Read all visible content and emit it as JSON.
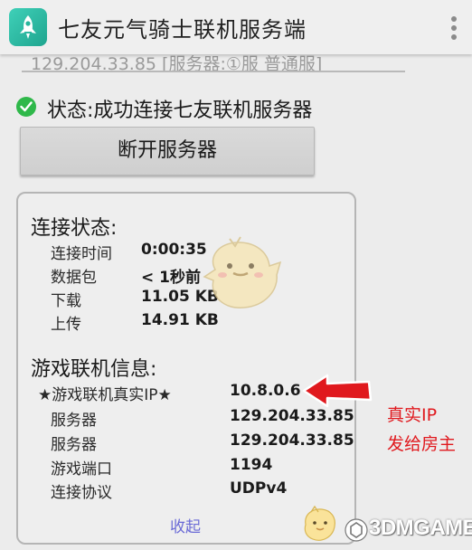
{
  "app": {
    "title": "七友元气骑士联机服务端",
    "icon": "rocket-icon",
    "accent_color": "#27b59c"
  },
  "server_line": "129.204.33.85 [服务器:①服 普通服]",
  "status": {
    "text": "状态:成功连接七友联机服务器",
    "icon": "check-circle-icon",
    "color": "#2fb84a"
  },
  "disconnect_button": "断开服务器",
  "connection": {
    "title": "连接状态:",
    "rows": [
      {
        "label": "连接时间",
        "value": "0:00:35"
      },
      {
        "label": "数据包",
        "value": "< 1秒前"
      },
      {
        "label": "下载",
        "value": "11.05 KB"
      },
      {
        "label": "上传",
        "value": "14.91 KB"
      }
    ]
  },
  "game": {
    "title": "游戏联机信息:",
    "rows": [
      {
        "label": "★游戏联机真实IP★",
        "value": "10.8.0.6"
      },
      {
        "label": "服务器",
        "value": "129.204.33.85"
      },
      {
        "label": "服务器",
        "value": "129.204.33.85"
      },
      {
        "label": "游戏端口",
        "value": "1194"
      },
      {
        "label": "连接协议",
        "value": "UDPv4"
      }
    ]
  },
  "collapse_label": "收起",
  "annotation": {
    "line1": "真实IP",
    "line2": "发给房主",
    "color": "#e0191e"
  },
  "watermark": "3DMGAME"
}
